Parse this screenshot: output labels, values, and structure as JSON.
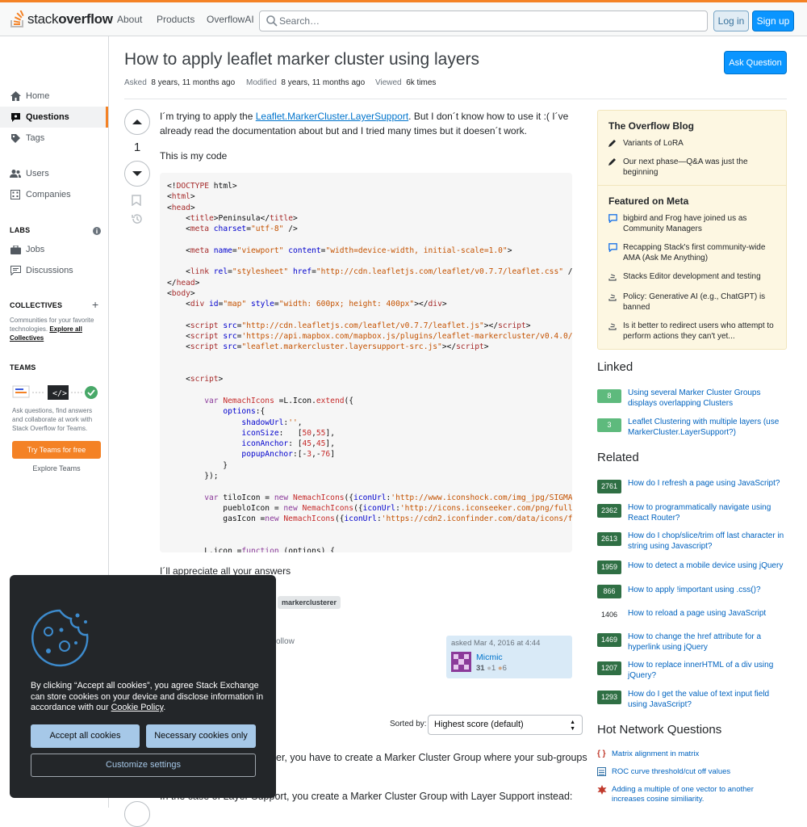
{
  "header": {
    "logo_text_light": "stack",
    "logo_text_bold": "overflow",
    "nav": [
      "About",
      "Products",
      "OverflowAI"
    ],
    "search_placeholder": "Search…",
    "login": "Log in",
    "signup": "Sign up"
  },
  "sidebar": {
    "items": [
      "Home",
      "Questions",
      "Tags",
      "Users",
      "Companies"
    ],
    "labs_heading": "LABS",
    "labs_items": [
      "Jobs",
      "Discussions"
    ],
    "collectives_heading": "COLLECTIVES",
    "collectives_text": "Communities for your favorite technologies.",
    "collectives_link": "Explore all Collectives",
    "teams_heading": "TEAMS",
    "teams_text": "Ask questions, find answers and collaborate at work with Stack Overflow for Teams.",
    "teams_button": "Try Teams for free",
    "teams_link": "Explore Teams"
  },
  "question": {
    "title": "How to apply leaflet marker cluster using layers",
    "ask_button": "Ask Question",
    "asked_label": "Asked",
    "asked_value": "8 years, 11 months ago",
    "modified_label": "Modified",
    "modified_value": "8 years, 11 months ago",
    "viewed_label": "Viewed",
    "viewed_value": "6k times",
    "score": "1",
    "text_1a": "I´m trying to apply the ",
    "link": "Leaflet.MarkerCluster.LayerSupport",
    "text_1b": ". But I don´t know how to use it :( I´ve already read the documentation about but and I tried many times but it doesen´t work.",
    "text_2": "This is my code",
    "text_3": "I´ll appreciate all your answers",
    "tags": [
      "markerclusterer"
    ],
    "follow": "ollow",
    "asked_on": "asked Mar 4, 2016 at 4:44",
    "user_name": "Micmic",
    "user_rep": "31",
    "user_silver": "1",
    "user_bronze": "6"
  },
  "answers": {
    "sorted_label": "Sorted by:",
    "sort_value": "Highest score (default)",
    "answer_line_1": "er, you have to create a Marker Cluster Group where your sub-groups",
    "answer_line_2": "In the case of Layer Support, you create a Marker Cluster Group with Layer Support instead:"
  },
  "blog": {
    "heading": "The Overflow Blog",
    "items": [
      "Variants of LoRA",
      "Our next phase—Q&A was just the beginning"
    ],
    "meta_heading": "Featured on Meta",
    "meta_items": [
      "bigbird and Frog have joined us as Community Managers",
      "Recapping Stack's first community-wide AMA (Ask Me Anything)",
      "Stacks Editor development and testing",
      "Policy: Generative AI (e.g., ChatGPT) is banned",
      "Is it better to redirect users who attempt to perform actions they can't yet..."
    ]
  },
  "linked": {
    "heading": "Linked",
    "items": [
      {
        "score": "8",
        "title": "Using several Marker Cluster Groups displays overlapping Clusters"
      },
      {
        "score": "3",
        "title": "Leaflet Clustering with multiple layers (use MarkerCluster.LayerSupport?)"
      }
    ]
  },
  "related": {
    "heading": "Related",
    "items": [
      {
        "score": "2761",
        "title": "How do I refresh a page using JavaScript?"
      },
      {
        "score": "2362",
        "title": "How to programmatically navigate using React Router?"
      },
      {
        "score": "2613",
        "title": "How do I chop/slice/trim off last character in string using Javascript?"
      },
      {
        "score": "1959",
        "title": "How to detect a mobile device using jQuery"
      },
      {
        "score": "866",
        "title": "How to apply !important using .css()?"
      },
      {
        "score": "1406",
        "title": "How to reload a page using JavaScript"
      },
      {
        "score": "1469",
        "title": "How to change the href attribute for a hyperlink using jQuery"
      },
      {
        "score": "1207",
        "title": "How to replace innerHTML of a div using jQuery?"
      },
      {
        "score": "1293",
        "title": "How do I get the value of text input field using JavaScript?"
      }
    ]
  },
  "hot": {
    "heading": "Hot Network Questions",
    "items": [
      "Matrix alignment in matrix",
      "ROC curve threshold/cut off values",
      "Adding a multiple of one vector to another increases cosine similiarity."
    ]
  },
  "cookie": {
    "text_a": "By clicking “Accept all cookies”, you agree Stack Exchange can store cookies on your device and disclose information in accordance with our ",
    "policy_link": "Cookie Policy",
    "accept": "Accept all cookies",
    "necessary": "Necessary cookies only",
    "customize": "Customize settings"
  },
  "colors": {
    "accent": "#f48225",
    "link": "#0074cc",
    "primary_button": "#0a95ff"
  }
}
